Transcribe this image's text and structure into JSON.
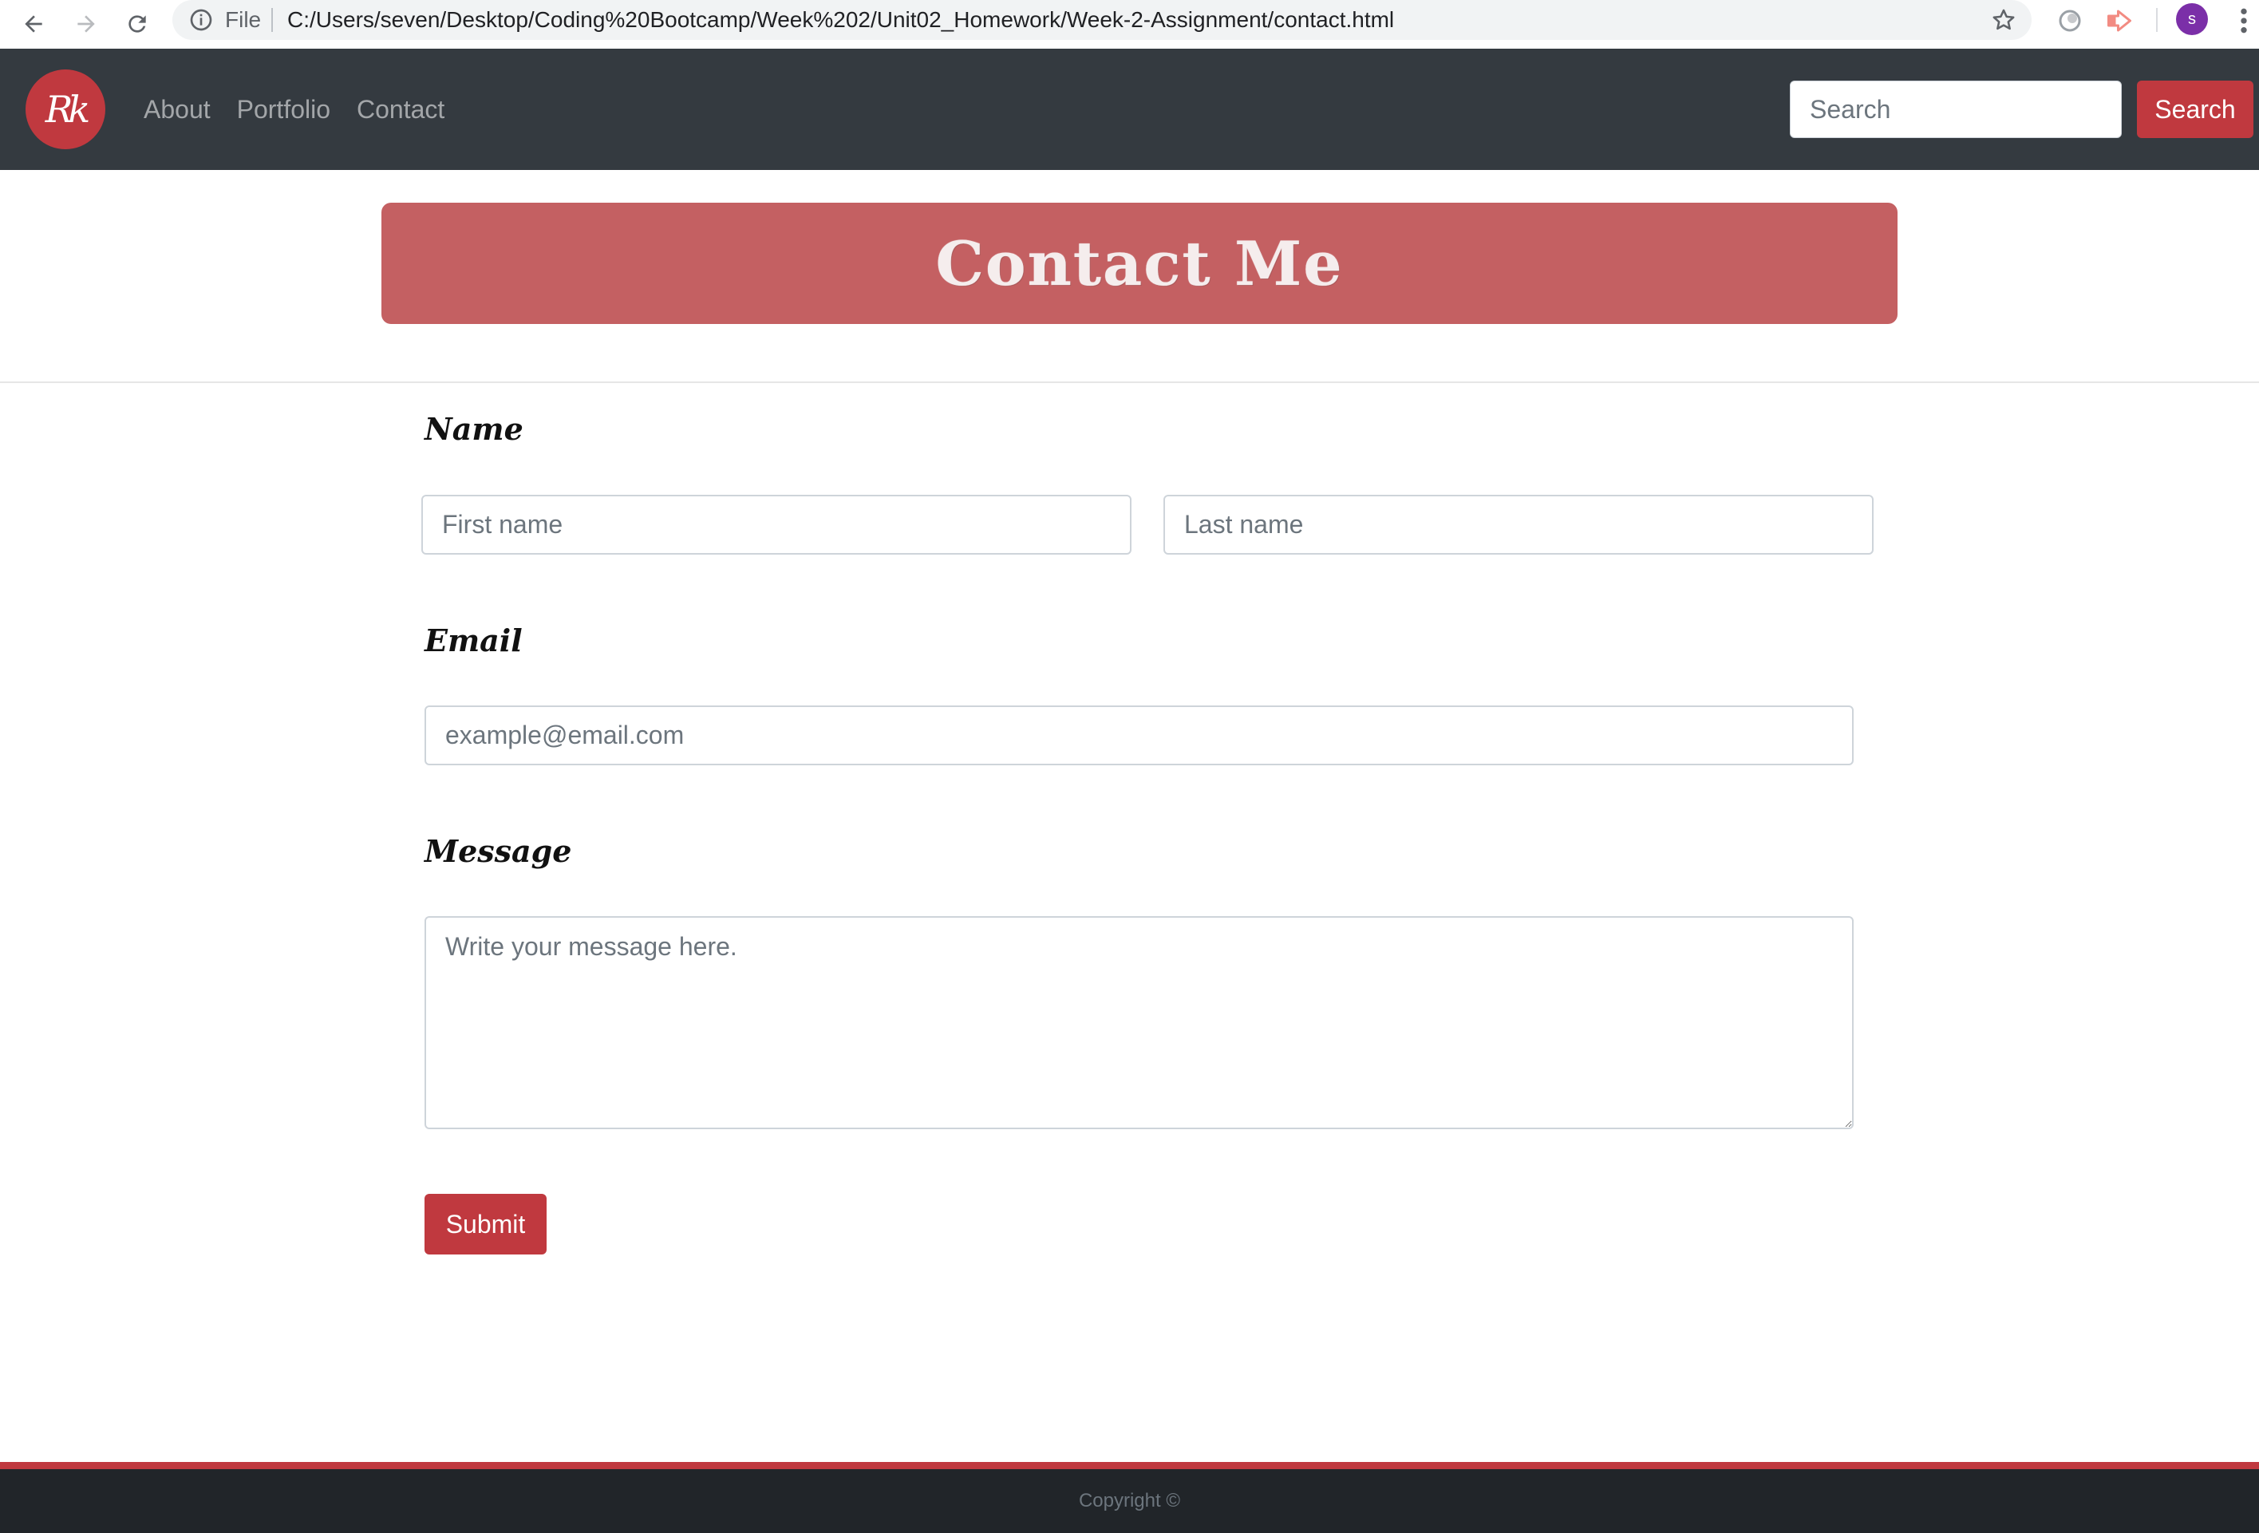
{
  "browser": {
    "file_label": "File",
    "url": "C:/Users/seven/Desktop/Coding%20Bootcamp/Week%202/Unit02_Homework/Week-2-Assignment/contact.html",
    "profile_initial": "s"
  },
  "navbar": {
    "logo_text": "Rk",
    "links": [
      "About",
      "Portfolio",
      "Contact"
    ],
    "search_placeholder": "Search",
    "search_button": "Search"
  },
  "banner": {
    "title": "Contact Me"
  },
  "form": {
    "name_label": "Name",
    "first_name_placeholder": "First name",
    "last_name_placeholder": "Last name",
    "email_label": "Email",
    "email_placeholder": "example@email.com",
    "message_label": "Message",
    "message_placeholder": "Write your message here.",
    "submit_label": "Submit"
  },
  "footer": {
    "copyright": "Copyright ©"
  },
  "colors": {
    "navbar_bg": "#343a40",
    "brand_red": "#c0393f",
    "banner_bg": "#c46062",
    "footer_bg": "#212529"
  }
}
